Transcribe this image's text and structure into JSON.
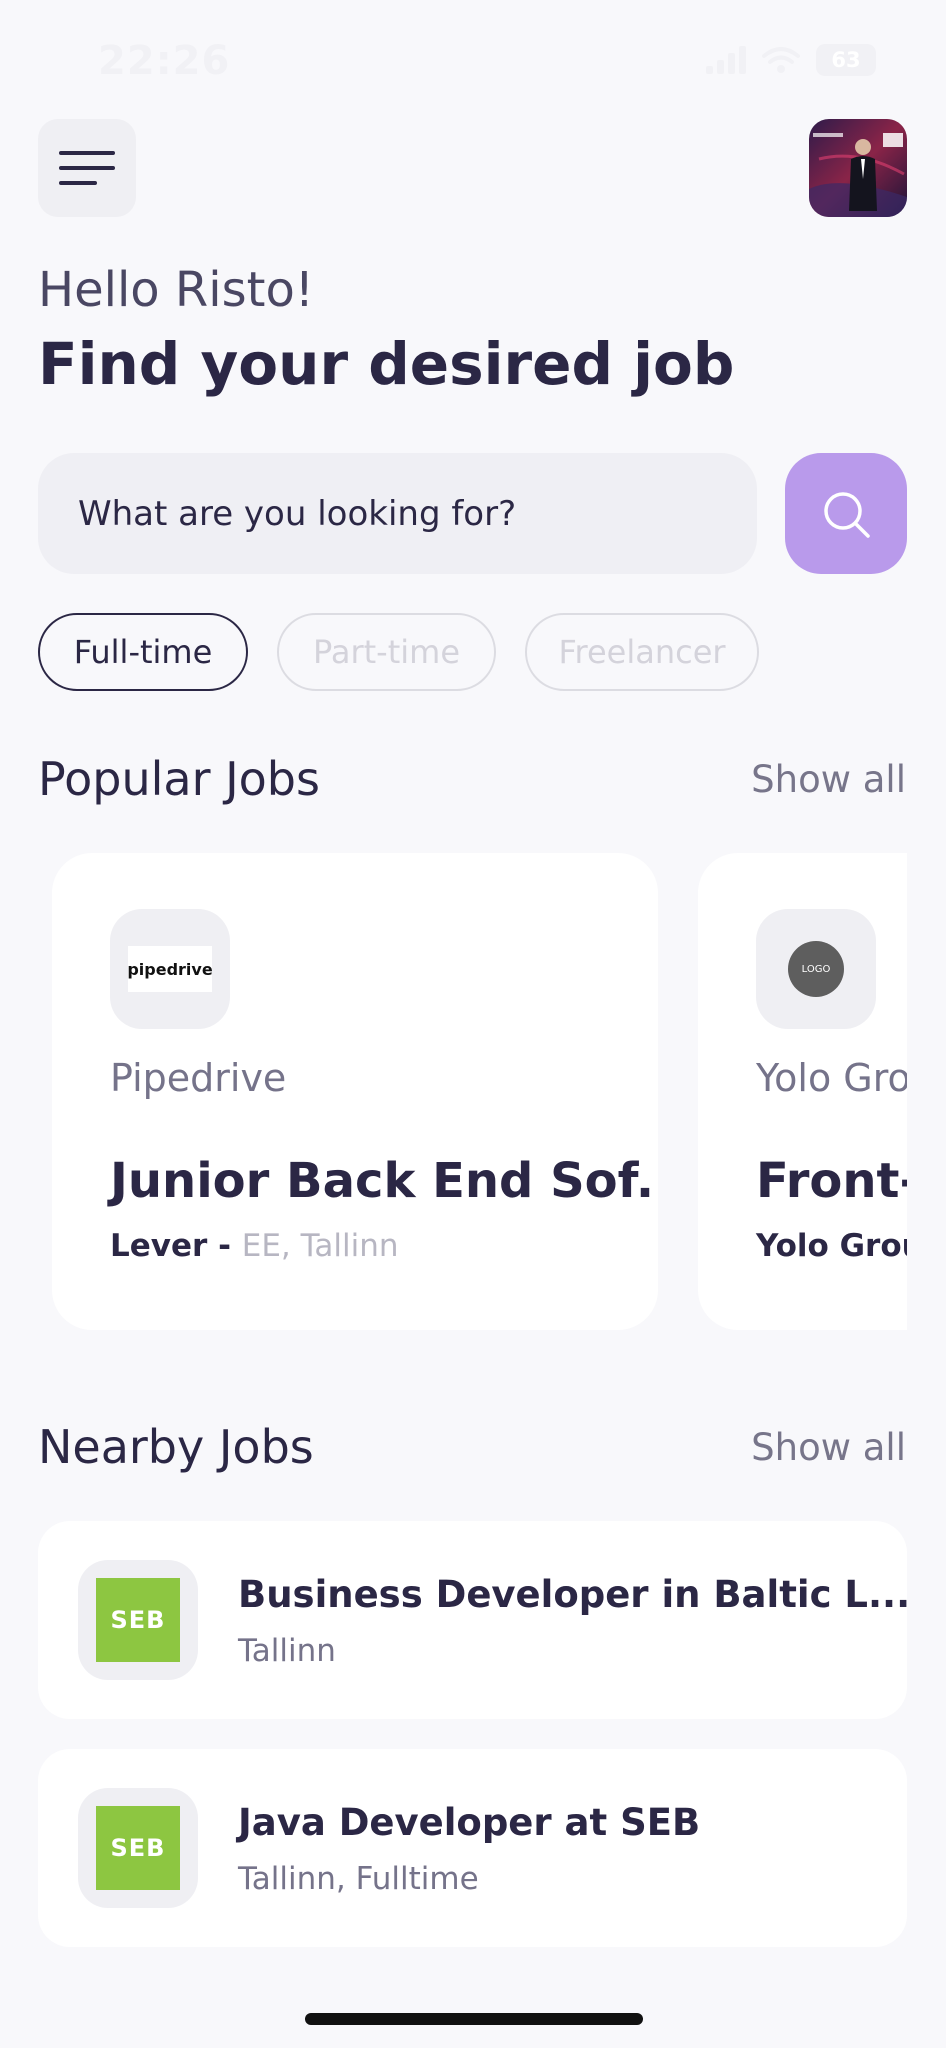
{
  "status_bar": {
    "time": "22:26",
    "battery": "63"
  },
  "header": {
    "greeting": "Hello Risto!",
    "headline": "Find your desired job"
  },
  "search": {
    "placeholder": "What are you looking for?"
  },
  "filters": [
    {
      "label": "Full-time",
      "active": true
    },
    {
      "label": "Part-time",
      "active": false
    },
    {
      "label": "Freelancer",
      "active": false
    }
  ],
  "popular": {
    "title": "Popular Jobs",
    "show_all": "Show all",
    "cards": [
      {
        "logo_text": "pipedrive",
        "company": "Pipedrive",
        "title": "Junior Back End Sof...",
        "source": "Lever - ",
        "location": "EE, Tallinn"
      },
      {
        "logo_text": "LOGO",
        "company": "Yolo Group",
        "title": "Front-End Developer",
        "source": "Yolo Group",
        "location": ""
      }
    ]
  },
  "nearby": {
    "title": "Nearby Jobs",
    "show_all": "Show all",
    "items": [
      {
        "logo_text": "SEB",
        "title": "Business Developer in Baltic L...",
        "subtitle": "Tallinn"
      },
      {
        "logo_text": "SEB",
        "title": "Java Developer at SEB",
        "subtitle": "Tallinn, Fulltime"
      }
    ]
  },
  "colors": {
    "accent": "#B99AEB",
    "text": "#2B2745",
    "seb_green": "#8DC641",
    "background": "#F8F8FB"
  }
}
